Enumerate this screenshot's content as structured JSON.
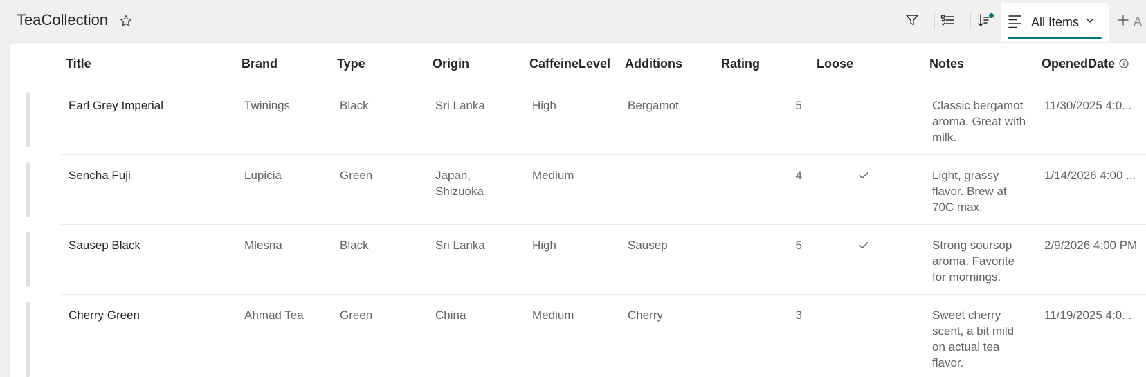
{
  "header": {
    "title": "TeaCollection",
    "star_icon": "star-icon",
    "toolbar": {
      "filter_icon": "filter-icon",
      "group_icon": "list-group-icon",
      "sort_icon": "sort-icon"
    },
    "view": {
      "label": "All Items",
      "icon": "lines-icon",
      "chevron": "chevron-down-icon"
    },
    "add_label": "A",
    "accent_color": "#03787c"
  },
  "columns": [
    {
      "key": "title",
      "label": "Title"
    },
    {
      "key": "brand",
      "label": "Brand"
    },
    {
      "key": "type",
      "label": "Type"
    },
    {
      "key": "origin",
      "label": "Origin"
    },
    {
      "key": "caffeine",
      "label": "CaffeineLevel"
    },
    {
      "key": "additions",
      "label": "Additions"
    },
    {
      "key": "rating",
      "label": "Rating"
    },
    {
      "key": "loose",
      "label": "Loose"
    },
    {
      "key": "notes",
      "label": "Notes"
    },
    {
      "key": "opened",
      "label": "OpenedDate"
    }
  ],
  "rows": [
    {
      "title": "Earl Grey Imperial",
      "brand": "Twinings",
      "type": "Black",
      "origin": "Sri Lanka",
      "caffeine": "High",
      "additions": "Bergamot",
      "rating": "5",
      "loose": false,
      "notes": "Classic bergamot aroma. Great with milk.",
      "opened": "11/30/2025 4:0..."
    },
    {
      "title": "Sencha Fuji",
      "brand": "Lupicia",
      "type": "Green",
      "origin": "Japan, Shizuoka",
      "caffeine": "Medium",
      "additions": "",
      "rating": "4",
      "loose": true,
      "notes": "Light, grassy flavor. Brew at 70C max.",
      "opened": "1/14/2026 4:00 ..."
    },
    {
      "title": "Sausep Black",
      "brand": "Mlesna",
      "type": "Black",
      "origin": "Sri Lanka",
      "caffeine": "High",
      "additions": "Sausep",
      "rating": "5",
      "loose": true,
      "notes": "Strong soursop aroma. Favorite for mornings.",
      "opened": "2/9/2026 4:00 PM"
    },
    {
      "title": "Cherry Green",
      "brand": "Ahmad Tea",
      "type": "Green",
      "origin": "China",
      "caffeine": "Medium",
      "additions": "Cherry",
      "rating": "3",
      "loose": false,
      "notes": "Sweet cherry scent, a bit mild on actual tea flavor.",
      "opened": "11/19/2025 4:0..."
    }
  ]
}
